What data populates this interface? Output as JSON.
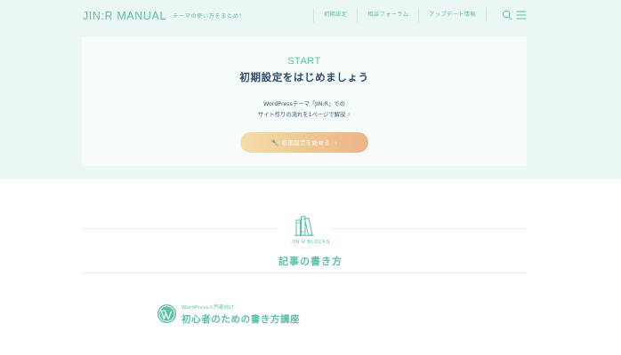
{
  "header": {
    "logo": "JIN:R MANUAL",
    "tagline": "テーマの使い方をまとめ！",
    "nav": [
      {
        "label": "初期設定"
      },
      {
        "label": "相談フォーラム"
      },
      {
        "label": "アップデート情報"
      }
    ]
  },
  "start": {
    "eyebrow": "START",
    "title": "初期設定をはじめましょう",
    "desc_line1": "WordPressテーマ「JIN:R」での",
    "desc_line2": "サイト作りの流れを1ページで解説 ☝",
    "button_label": "初期設定を始める"
  },
  "blocks": {
    "label": "JIN:R BLOCKS",
    "title": "記事の書き方"
  },
  "course": {
    "subtitle": "WordPress入門者向け",
    "title": "初心者のための書き方講座"
  },
  "colors": {
    "accent": "#5cbfa8",
    "hero_bg": "#eaf7f4",
    "title_navy": "#2f4a6e",
    "button_gradient_start": "#f3deaa",
    "button_gradient_end": "#eeb389"
  },
  "icons": {
    "header_search": "search-icon",
    "header_menu": "hamburger-menu-icon",
    "button": "wrench-icon",
    "button_arrow": "chevron-right-icon",
    "section": "books-icon",
    "course": "wordpress-icon"
  }
}
